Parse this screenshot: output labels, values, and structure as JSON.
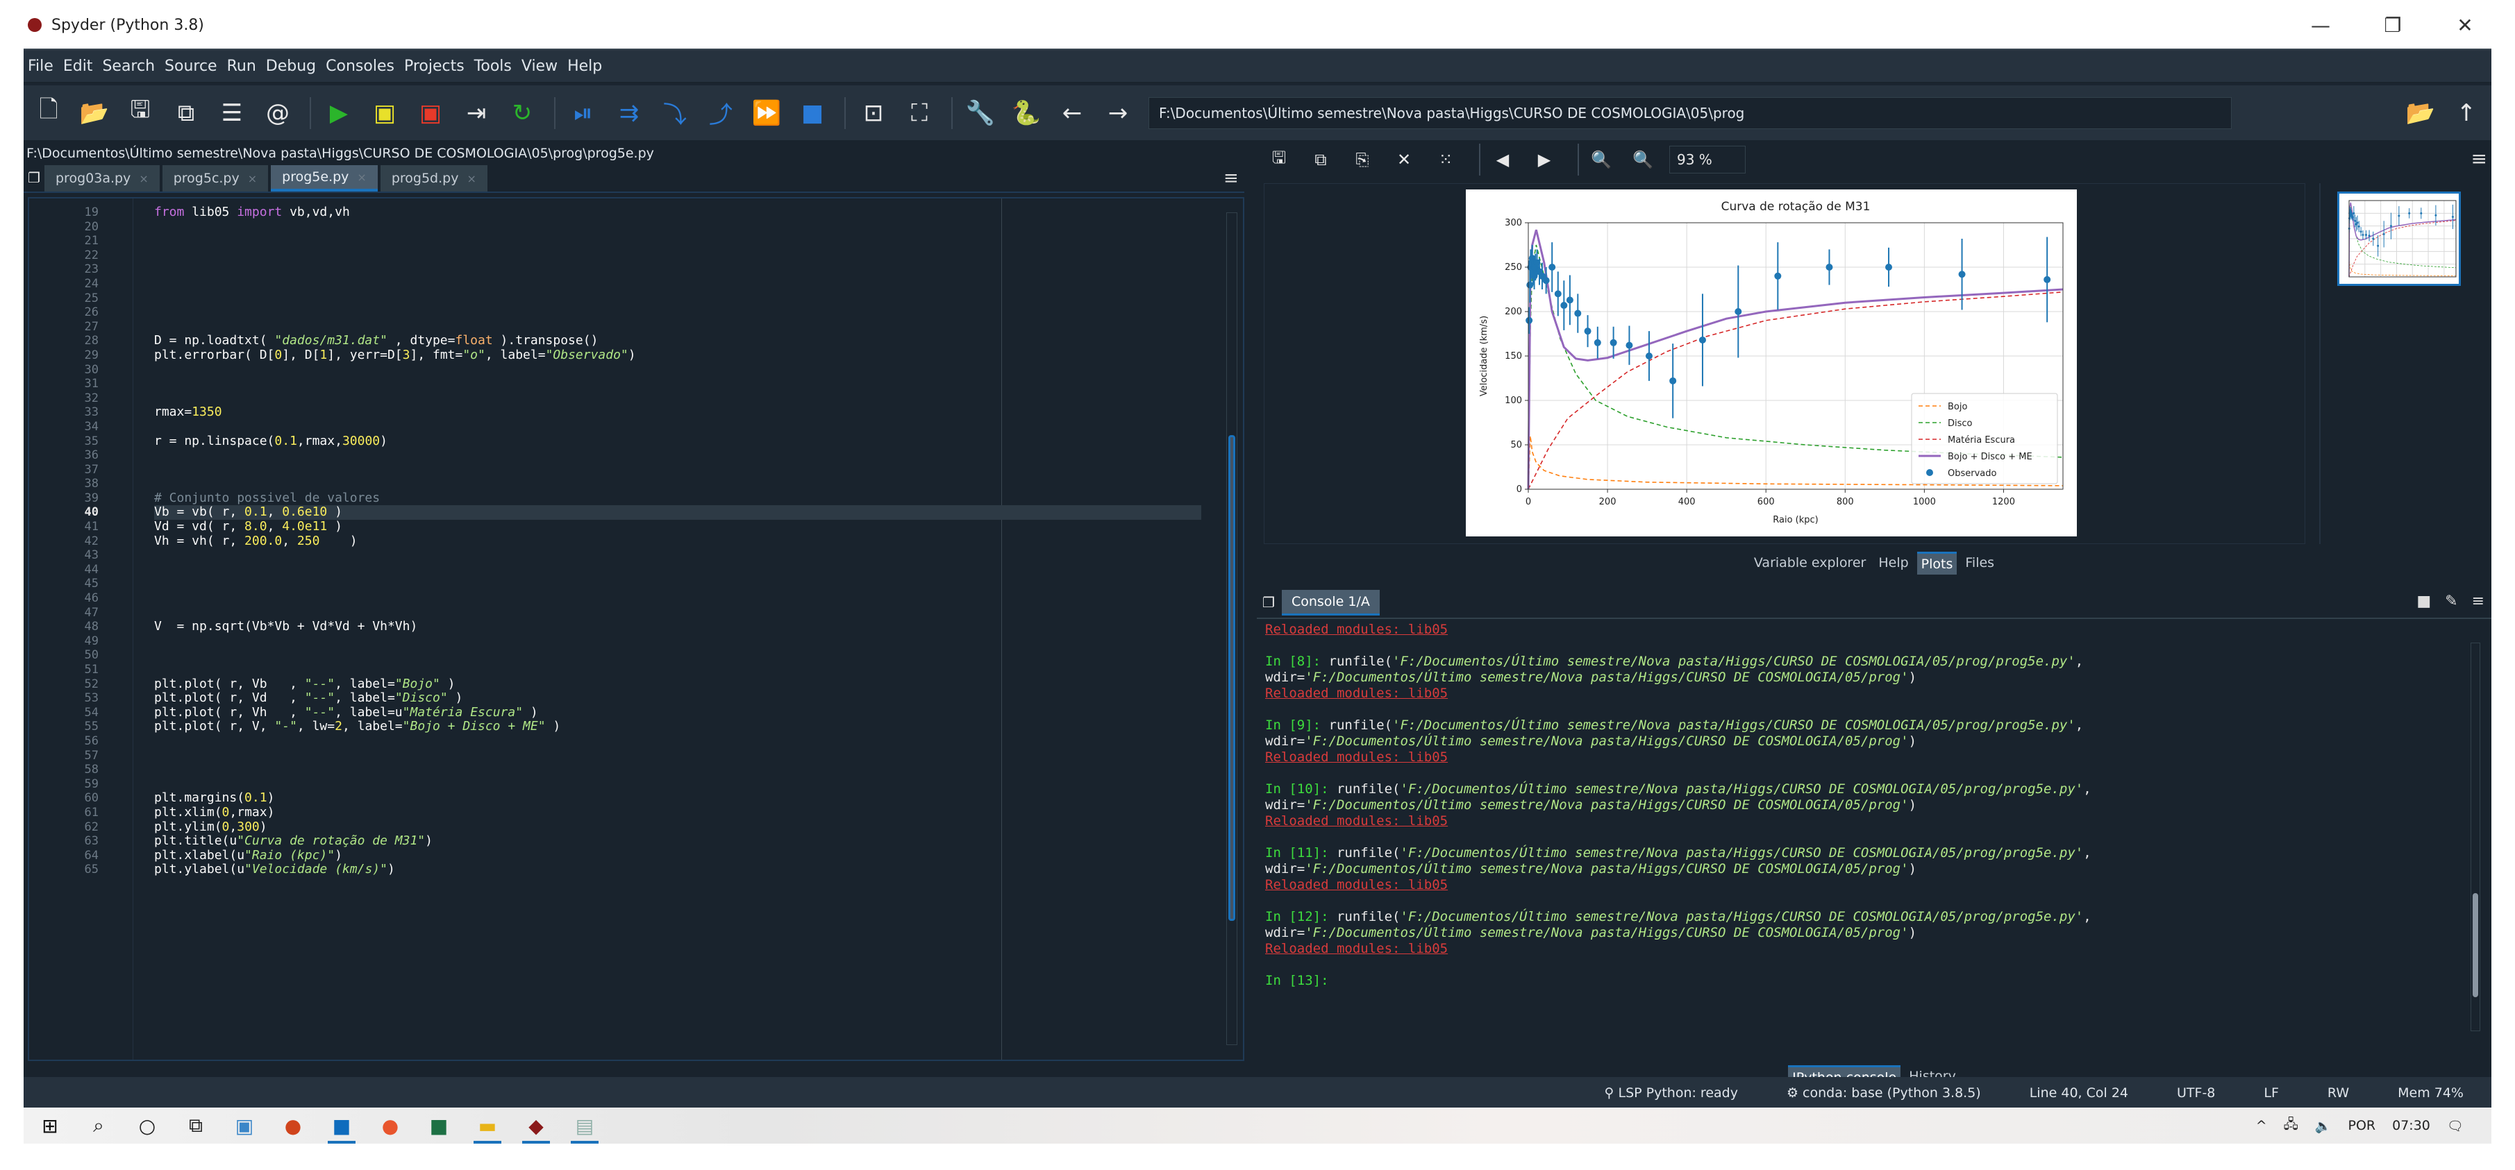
{
  "window": {
    "title": "Spyder (Python 3.8)",
    "controls": {
      "minimize": "—",
      "maximize": "❐",
      "close": "✕"
    }
  },
  "menubar": [
    "File",
    "Edit",
    "Search",
    "Source",
    "Run",
    "Debug",
    "Consoles",
    "Projects",
    "Tools",
    "View",
    "Help"
  ],
  "toolbar": {
    "buttons": [
      {
        "name": "new-file-icon",
        "glyph": "🗋"
      },
      {
        "name": "open-file-icon",
        "glyph": "📂"
      },
      {
        "name": "save-icon",
        "glyph": "🖫"
      },
      {
        "name": "save-all-icon",
        "glyph": "⧉"
      },
      {
        "name": "outline-icon",
        "glyph": "☰"
      },
      {
        "name": "at-icon",
        "glyph": "@"
      },
      {
        "name": "run-icon",
        "glyph": "▶"
      },
      {
        "name": "run-cell-icon",
        "glyph": "▣"
      },
      {
        "name": "run-cell-advance-icon",
        "glyph": "▣"
      },
      {
        "name": "run-selection-icon",
        "glyph": "⇥"
      },
      {
        "name": "rerun-icon",
        "glyph": "↻"
      },
      {
        "name": "debug-icon",
        "glyph": "⏯"
      },
      {
        "name": "debug-step-icon",
        "glyph": "⇉"
      },
      {
        "name": "debug-step-into-icon",
        "glyph": "⤵"
      },
      {
        "name": "debug-step-return-icon",
        "glyph": "⤴"
      },
      {
        "name": "debug-continue-icon",
        "glyph": "⏩"
      },
      {
        "name": "debug-stop-icon",
        "glyph": "■"
      },
      {
        "name": "maximize-pane-icon",
        "glyph": "⊡"
      },
      {
        "name": "fullscreen-icon",
        "glyph": "⛶"
      },
      {
        "name": "preferences-icon",
        "glyph": "🔧"
      },
      {
        "name": "python-path-icon",
        "glyph": "🐍"
      },
      {
        "name": "back-icon",
        "glyph": "←"
      },
      {
        "name": "forward-icon",
        "glyph": "→"
      }
    ],
    "working_dir": "F:\\Documentos\\Último semestre\\Nova pasta\\Higgs\\CURSO DE COSMOLOGIA\\05\\prog",
    "browse_glyph": "📂",
    "parent_glyph": "↑"
  },
  "editor": {
    "path": "F:\\Documentos\\Último semestre\\Nova pasta\\Higgs\\CURSO DE COSMOLOGIA\\05\\prog\\prog5e.py",
    "tabs": [
      {
        "label": "prog03a.py",
        "active": false
      },
      {
        "label": "prog5c.py",
        "active": false
      },
      {
        "label": "prog5e.py",
        "active": true
      },
      {
        "label": "prog5d.py",
        "active": false
      }
    ],
    "current_line": 40,
    "lines": [
      {
        "n": 19,
        "html": "<span class='kw'>from</span> lib05 <span class='kw'>import</span> vb,vd,vh"
      },
      {
        "n": 20,
        "html": ""
      },
      {
        "n": 21,
        "html": ""
      },
      {
        "n": 22,
        "html": ""
      },
      {
        "n": 23,
        "html": ""
      },
      {
        "n": 24,
        "html": ""
      },
      {
        "n": 25,
        "html": ""
      },
      {
        "n": 26,
        "html": ""
      },
      {
        "n": 27,
        "html": ""
      },
      {
        "n": 28,
        "html": "D = np.loadtxt( <span class='str'>\"dados/m31.dat\"</span> , dtype=<span class='blt'>float</span> ).transpose()"
      },
      {
        "n": 29,
        "html": "plt.errorbar( D[<span class='num'>0</span>], D[<span class='num'>1</span>], yerr=D[<span class='num'>3</span>], fmt=<span class='str'>\"o\"</span>, label=<span class='str'>\"Observado\"</span>)"
      },
      {
        "n": 30,
        "html": ""
      },
      {
        "n": 31,
        "html": ""
      },
      {
        "n": 32,
        "html": ""
      },
      {
        "n": 33,
        "html": "rmax=<span class='num'>1350</span>"
      },
      {
        "n": 34,
        "html": ""
      },
      {
        "n": 35,
        "html": "r = np.linspace(<span class='num'>0.1</span>,rmax,<span class='num'>30000</span>)"
      },
      {
        "n": 36,
        "html": ""
      },
      {
        "n": 37,
        "html": ""
      },
      {
        "n": 38,
        "html": ""
      },
      {
        "n": 39,
        "html": "<span class='cmt'># Conjunto possivel de valores</span>"
      },
      {
        "n": 40,
        "html": "Vb = vb( r, <span class='num'>0.1</span>, <span class='num'>0.6e10</span> )"
      },
      {
        "n": 41,
        "html": "Vd = vd( r, <span class='num'>8.0</span>, <span class='num'>4.0e11</span> )"
      },
      {
        "n": 42,
        "html": "Vh = vh( r, <span class='num'>200.0</span>, <span class='num'>250</span>    )"
      },
      {
        "n": 43,
        "html": ""
      },
      {
        "n": 44,
        "html": ""
      },
      {
        "n": 45,
        "html": ""
      },
      {
        "n": 46,
        "html": ""
      },
      {
        "n": 47,
        "html": ""
      },
      {
        "n": 48,
        "html": "V  = np.sqrt(Vb*Vb + Vd*Vd + Vh*Vh)"
      },
      {
        "n": 49,
        "html": ""
      },
      {
        "n": 50,
        "html": ""
      },
      {
        "n": 51,
        "html": ""
      },
      {
        "n": 52,
        "html": "plt.plot( r, Vb   , <span class='str'>\"--\"</span>, label=<span class='str'>\"Bojo\"</span> )"
      },
      {
        "n": 53,
        "html": "plt.plot( r, Vd   , <span class='str'>\"--\"</span>, label=<span class='str'>\"Disco\"</span> )"
      },
      {
        "n": 54,
        "html": "plt.plot( r, Vh   , <span class='str'>\"--\"</span>, label=u<span class='str'>\"Matéria Escura\"</span> )"
      },
      {
        "n": 55,
        "html": "plt.plot( r, V, <span class='str'>\"-\"</span>, lw=<span class='num'>2</span>, label=<span class='str'>\"Bojo + Disco + ME\"</span> )"
      },
      {
        "n": 56,
        "html": ""
      },
      {
        "n": 57,
        "html": ""
      },
      {
        "n": 58,
        "html": ""
      },
      {
        "n": 59,
        "html": ""
      },
      {
        "n": 60,
        "html": "plt.margins(<span class='num'>0.1</span>)"
      },
      {
        "n": 61,
        "html": "plt.xlim(<span class='num'>0</span>,rmax)"
      },
      {
        "n": 62,
        "html": "plt.ylim(<span class='num'>0</span>,<span class='num'>300</span>)"
      },
      {
        "n": 63,
        "html": "plt.title(u<span class='str'>\"Curva de rotação de M31\"</span>)"
      },
      {
        "n": 64,
        "html": "plt.xlabel(u<span class='str'>\"Raio (kpc)\"</span>)"
      },
      {
        "n": 65,
        "html": "plt.ylabel(u<span class='str'>\"Velocidade (km/s)\"</span>)"
      }
    ]
  },
  "plots": {
    "toolbar": [
      {
        "name": "save-plot-icon",
        "glyph": "🖫"
      },
      {
        "name": "save-all-plots-icon",
        "glyph": "⧉"
      },
      {
        "name": "copy-plot-icon",
        "glyph": "⎘"
      },
      {
        "name": "remove-plot-icon",
        "glyph": "✕"
      },
      {
        "name": "remove-all-plots-icon",
        "glyph": "⁙"
      },
      {
        "name": "previous-plot-icon",
        "glyph": "◀"
      },
      {
        "name": "next-plot-icon",
        "glyph": "▶"
      },
      {
        "name": "zoom-out-icon",
        "glyph": "🔍"
      },
      {
        "name": "zoom-in-icon",
        "glyph": "🔍"
      }
    ],
    "zoom": "93 %",
    "pane_tabs": [
      {
        "label": "Variable explorer",
        "active": false
      },
      {
        "label": "Help",
        "active": false
      },
      {
        "label": "Plots",
        "active": true
      },
      {
        "label": "Files",
        "active": false
      }
    ]
  },
  "chart_data": {
    "type": "line",
    "title": "Curva de rotação de M31",
    "xlabel": "Raio (kpc)",
    "ylabel": "Velocidade (km/s)",
    "xlim": [
      0,
      1350
    ],
    "ylim": [
      0,
      300
    ],
    "xticks": [
      0,
      200,
      400,
      600,
      800,
      1000,
      1200
    ],
    "yticks": [
      0,
      50,
      100,
      150,
      200,
      250,
      300
    ],
    "grid": true,
    "legend_position": "lower-right",
    "legend": [
      "Bojo",
      "Disco",
      "Matéria Escura",
      "Bojo + Disco + ME",
      "Observado"
    ],
    "series": [
      {
        "name": "Bojo",
        "style": "dashed",
        "color": "#ff7f0e",
        "x": [
          0,
          5,
          10,
          20,
          40,
          80,
          150,
          300,
          600,
          1000,
          1350
        ],
        "y": [
          0,
          60,
          42,
          30,
          21,
          15,
          11,
          8,
          6,
          5,
          4
        ]
      },
      {
        "name": "Disco",
        "style": "dashed",
        "color": "#2ca02c",
        "x": [
          0,
          5,
          10,
          20,
          40,
          80,
          120,
          170,
          250,
          350,
          500,
          700,
          900,
          1100,
          1350
        ],
        "y": [
          0,
          180,
          250,
          275,
          240,
          170,
          130,
          100,
          82,
          70,
          58,
          50,
          44,
          40,
          36
        ]
      },
      {
        "name": "Matéria Escura",
        "style": "dashed",
        "color": "#d62728",
        "x": [
          0,
          50,
          100,
          170,
          250,
          350,
          450,
          600,
          800,
          1000,
          1200,
          1350
        ],
        "y": [
          0,
          45,
          80,
          105,
          132,
          155,
          172,
          190,
          203,
          211,
          217,
          222
        ]
      },
      {
        "name": "Bojo + Disco + ME",
        "style": "solid",
        "color": "#9467bd",
        "x": [
          0,
          5,
          10,
          20,
          40,
          60,
          90,
          120,
          150,
          200,
          300,
          400,
          500,
          600,
          800,
          1000,
          1200,
          1350
        ],
        "y": [
          0,
          230,
          275,
          292,
          255,
          200,
          160,
          147,
          145,
          148,
          163,
          178,
          192,
          200,
          210,
          216,
          221,
          225
        ]
      }
    ],
    "observed": {
      "name": "Observado",
      "color": "#1f77b4",
      "x": [
        2,
        4,
        6,
        8,
        10,
        12,
        15,
        18,
        22,
        28,
        35,
        45,
        60,
        75,
        90,
        105,
        125,
        150,
        175,
        215,
        255,
        305,
        365,
        440,
        530,
        630,
        760,
        910,
        1095,
        1310
      ],
      "y": [
        190,
        230,
        250,
        255,
        260,
        245,
        240,
        250,
        255,
        245,
        240,
        235,
        250,
        220,
        207,
        213,
        198,
        178,
        165,
        165,
        162,
        150,
        122,
        168,
        200,
        240,
        250,
        250,
        242,
        236
      ],
      "yerr": [
        15,
        20,
        20,
        15,
        15,
        15,
        15,
        15,
        15,
        15,
        15,
        15,
        28,
        25,
        28,
        28,
        22,
        18,
        18,
        18,
        22,
        28,
        42,
        52,
        52,
        38,
        20,
        22,
        40,
        48
      ]
    }
  },
  "console": {
    "tab_label": "Console 1/A",
    "lines": [
      {
        "type": "reload",
        "text": "Reloaded modules: lib05"
      },
      {
        "type": "blank"
      },
      {
        "type": "in",
        "n": 8,
        "cmd": "runfile(",
        "arg": "'F:/Documentos/Último semestre/Nova pasta/Higgs/CURSO DE COSMOLOGIA/05/prog/prog5e.py'",
        "tail": ","
      },
      {
        "type": "wdir",
        "text": "wdir=",
        "arg": "'F:/Documentos/Último semestre/Nova pasta/Higgs/CURSO DE COSMOLOGIA/05/prog'",
        "tail": ")"
      },
      {
        "type": "reload",
        "text": "Reloaded modules: lib05"
      },
      {
        "type": "blank"
      },
      {
        "type": "in",
        "n": 9,
        "cmd": "runfile(",
        "arg": "'F:/Documentos/Último semestre/Nova pasta/Higgs/CURSO DE COSMOLOGIA/05/prog/prog5e.py'",
        "tail": ","
      },
      {
        "type": "wdir",
        "text": "wdir=",
        "arg": "'F:/Documentos/Último semestre/Nova pasta/Higgs/CURSO DE COSMOLOGIA/05/prog'",
        "tail": ")"
      },
      {
        "type": "reload",
        "text": "Reloaded modules: lib05"
      },
      {
        "type": "blank"
      },
      {
        "type": "in",
        "n": 10,
        "cmd": "runfile(",
        "arg": "'F:/Documentos/Último semestre/Nova pasta/Higgs/CURSO DE COSMOLOGIA/05/prog/prog5e.py'",
        "tail": ","
      },
      {
        "type": "wdir",
        "text": "wdir=",
        "arg": "'F:/Documentos/Último semestre/Nova pasta/Higgs/CURSO DE COSMOLOGIA/05/prog'",
        "tail": ")"
      },
      {
        "type": "reload",
        "text": "Reloaded modules: lib05"
      },
      {
        "type": "blank"
      },
      {
        "type": "in",
        "n": 11,
        "cmd": "runfile(",
        "arg": "'F:/Documentos/Último semestre/Nova pasta/Higgs/CURSO DE COSMOLOGIA/05/prog/prog5e.py'",
        "tail": ","
      },
      {
        "type": "wdir",
        "text": "wdir=",
        "arg": "'F:/Documentos/Último semestre/Nova pasta/Higgs/CURSO DE COSMOLOGIA/05/prog'",
        "tail": ")"
      },
      {
        "type": "reload",
        "text": "Reloaded modules: lib05"
      },
      {
        "type": "blank"
      },
      {
        "type": "in",
        "n": 12,
        "cmd": "runfile(",
        "arg": "'F:/Documentos/Último semestre/Nova pasta/Higgs/CURSO DE COSMOLOGIA/05/prog/prog5e.py'",
        "tail": ","
      },
      {
        "type": "wdir",
        "text": "wdir=",
        "arg": "'F:/Documentos/Último semestre/Nova pasta/Higgs/CURSO DE COSMOLOGIA/05/prog'",
        "tail": ")"
      },
      {
        "type": "reload",
        "text": "Reloaded modules: lib05"
      },
      {
        "type": "blank"
      },
      {
        "type": "in",
        "n": 13,
        "cmd": "",
        "arg": "",
        "tail": ""
      }
    ],
    "bottom_tabs": [
      {
        "label": "IPython console",
        "active": true
      },
      {
        "label": "History",
        "active": false
      }
    ]
  },
  "statusbar": {
    "lsp": "LSP Python: ready",
    "env": "conda: base (Python 3.8.5)",
    "position": "Line 40, Col 24",
    "encoding": "UTF-8",
    "eol": "LF",
    "mode": "RW",
    "memory": "Mem 74%"
  },
  "taskbar": {
    "apps": [
      {
        "name": "windows-start-icon",
        "glyph": "⊞",
        "color": "#111",
        "running": false
      },
      {
        "name": "search-icon",
        "glyph": "⌕",
        "color": "#222",
        "running": false
      },
      {
        "name": "cortana-icon",
        "glyph": "○",
        "color": "#222",
        "running": false
      },
      {
        "name": "task-view-icon",
        "glyph": "⧉",
        "color": "#222",
        "running": false
      },
      {
        "name": "photos-app-icon",
        "glyph": "▣",
        "color": "#3a86c8",
        "running": false
      },
      {
        "name": "powerpoint-icon",
        "glyph": "●",
        "color": "#d0441c",
        "running": false
      },
      {
        "name": "outlook-icon",
        "glyph": "■",
        "color": "#0f6cbd",
        "running": true
      },
      {
        "name": "firefox-icon",
        "glyph": "●",
        "color": "#e8552d",
        "running": false
      },
      {
        "name": "excel-icon",
        "glyph": "■",
        "color": "#1d7044",
        "running": false
      },
      {
        "name": "file-explorer-icon",
        "glyph": "▬",
        "color": "#e8b418",
        "running": true
      },
      {
        "name": "spyder-icon",
        "glyph": "◆",
        "color": "#8b1a1a",
        "running": true
      },
      {
        "name": "notepad-icon",
        "glyph": "▤",
        "color": "#8fb0a8",
        "running": true
      }
    ],
    "tray": {
      "chevron": "^",
      "network": "🖧",
      "volume": "🔈",
      "language": "POR",
      "time": "07:30",
      "notifications": "🗨"
    }
  }
}
